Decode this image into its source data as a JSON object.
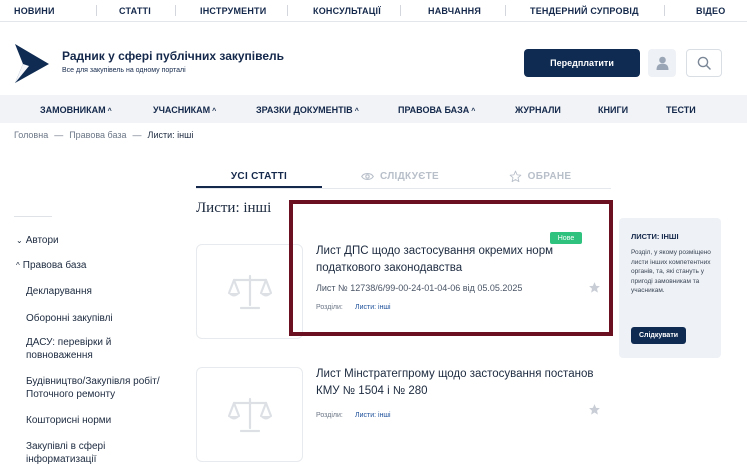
{
  "top_nav": [
    "НОВИНИ",
    "СТАТТІ",
    "ІНСТРУМЕНТИ",
    "КОНСУЛЬТАЦІЇ",
    "НАВЧАННЯ",
    "ТЕНДЕРНИЙ СУПРОВІД",
    "ВІДЕО"
  ],
  "brand": {
    "title": "Радник у сфері публічних закупівель",
    "subtitle": "Все для закупівель на одному порталі"
  },
  "header": {
    "subscribe_label": "Передплатити",
    "user_icon": "user-icon",
    "search_icon": "search-icon"
  },
  "main_nav": [
    {
      "label": "ЗАМОВНИКАМ",
      "has_caret": true
    },
    {
      "label": "УЧАСНИКАМ",
      "has_caret": true
    },
    {
      "label": "ЗРАЗКИ ДОКУМЕНТІВ",
      "has_caret": true
    },
    {
      "label": "ПРАВОВА БАЗА",
      "has_caret": true
    },
    {
      "label": "ЖУРНАЛИ",
      "has_caret": false
    },
    {
      "label": "КНИГИ",
      "has_caret": false
    },
    {
      "label": "ТЕСТИ",
      "has_caret": false
    }
  ],
  "breadcrumb": {
    "home": "Головна",
    "section": "Правова база",
    "current": "Листи: інші",
    "separator": "—"
  },
  "tabs": {
    "all": "УСІ СТАТТІ",
    "following": "СЛІДКУЄТЕ",
    "favorites": "ОБРАНЕ"
  },
  "page_title": "Листи: інші",
  "sidebar": {
    "groups": [
      {
        "label": "Автори",
        "arrow": "⌄"
      },
      {
        "label": "Правова база",
        "arrow": "^"
      }
    ],
    "items": [
      "Декларування",
      "Оборонні закупівлі",
      "ДАСУ: перевірки й повноваження",
      "Будівництво/Закупівля робіт/ Поточного ремонту",
      "Кошторисні норми",
      "Закупівлі в сфері інформатизації"
    ]
  },
  "articles": [
    {
      "title": "Лист ДПС щодо застосування окремих норм податкового законодавства",
      "meta": "Лист № 12738/6/99-00-24-01-04-06 від 05.05.2025",
      "sections_label": "Розділи:",
      "section_link": "Листи: інші",
      "badge": "Нове"
    },
    {
      "title": "Лист Мінстратегпрому щодо застосування постанов КМУ № 1504 і № 280",
      "sections_label": "Розділи:",
      "section_link": "Листи: інші"
    }
  ],
  "info_box": {
    "title": "ЛИСТИ: ІНШІ",
    "text": "Розділ, у якому розміщено листи інших компетентних органів, та, які стануть у пригоді замовникам та учасникам.",
    "button": "Слідкувати"
  },
  "colors": {
    "brand_navy": "#0f2b52",
    "new_badge": "#2ec27e",
    "highlight": "#6b1020"
  }
}
